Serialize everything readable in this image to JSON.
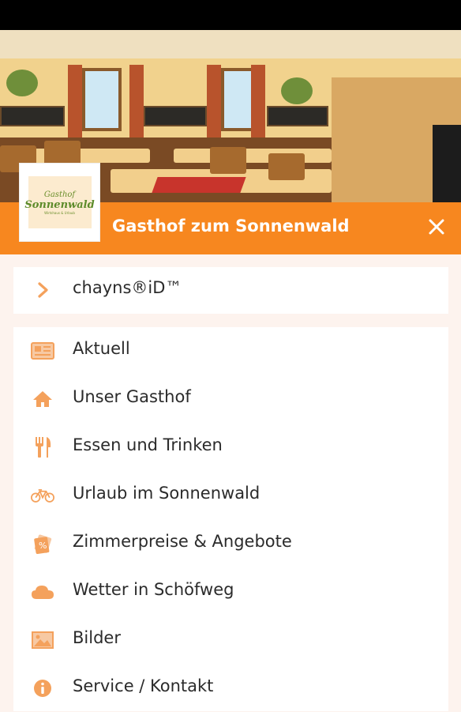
{
  "header": {
    "title": "Gasthof zum Sonnenwald",
    "close_label": "✕"
  },
  "logo": {
    "line1": "Gasthof",
    "line2": "Sonnenwald",
    "line3": "Wirtshaus & Urlaub"
  },
  "id_card": {
    "label": "chayns®iD™",
    "icon": "chevron-right-icon"
  },
  "menu": {
    "items": [
      {
        "label": "Aktuell",
        "icon": "newspaper-icon"
      },
      {
        "label": "Unser Gasthof",
        "icon": "home-icon"
      },
      {
        "label": "Essen und Trinken",
        "icon": "cutlery-icon"
      },
      {
        "label": "Urlaub im Sonnenwald",
        "icon": "bicycle-icon"
      },
      {
        "label": "Zimmerpreise & Angebote",
        "icon": "tag-icon"
      },
      {
        "label": "Wetter in Schöfweg",
        "icon": "cloud-icon"
      },
      {
        "label": "Bilder",
        "icon": "image-icon"
      },
      {
        "label": "Service / Kontakt",
        "icon": "info-icon"
      }
    ]
  },
  "colors": {
    "accent": "#f7871f",
    "icon": "#f4a15c",
    "background": "#fdf3ee"
  }
}
